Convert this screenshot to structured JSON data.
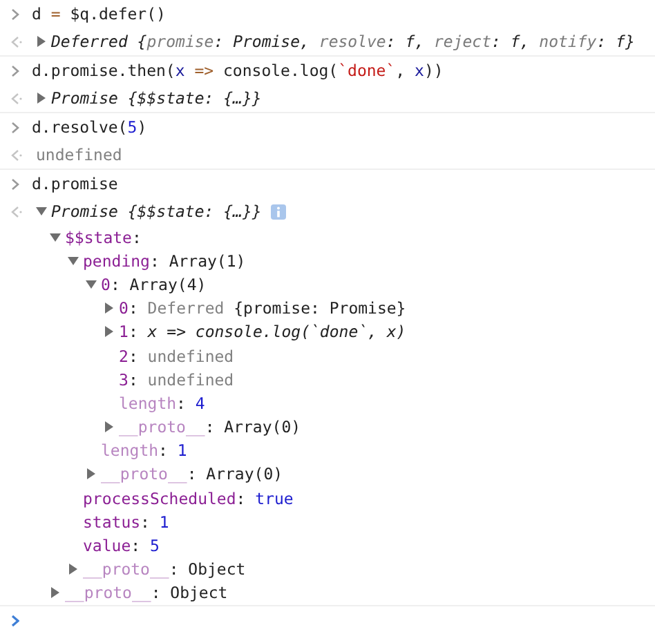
{
  "entries": [
    {
      "input": [
        {
          "text": "d ",
          "kind": "plain"
        },
        {
          "text": "=",
          "kind": "op"
        },
        {
          "text": " $q.defer()",
          "kind": "plain"
        }
      ],
      "result": {
        "expanded": false,
        "tokens": [
          {
            "text": "Deferred {",
            "kind": "italic"
          },
          {
            "text": "promise",
            "kind": "italic-gray"
          },
          {
            "text": ": Promise, ",
            "kind": "italic"
          },
          {
            "text": "resolve",
            "kind": "italic-gray"
          },
          {
            "text": ": f, ",
            "kind": "italic"
          },
          {
            "text": "reject",
            "kind": "italic-gray"
          },
          {
            "text": ": f, ",
            "kind": "italic"
          },
          {
            "text": "notify",
            "kind": "italic-gray"
          },
          {
            "text": ": f}",
            "kind": "italic"
          }
        ]
      }
    },
    {
      "input": [
        {
          "text": "d.promise.then(",
          "kind": "plain"
        },
        {
          "text": "x",
          "kind": "var"
        },
        {
          "text": " =>",
          "kind": "op"
        },
        {
          "text": " console.log(",
          "kind": "plain"
        },
        {
          "text": "`done`",
          "kind": "str"
        },
        {
          "text": ", ",
          "kind": "plain"
        },
        {
          "text": "x",
          "kind": "var"
        },
        {
          "text": "))",
          "kind": "plain"
        }
      ],
      "result": {
        "expanded": false,
        "tokens": [
          {
            "text": "Promise {$$state: {…}}",
            "kind": "italic"
          }
        ]
      }
    },
    {
      "input": [
        {
          "text": "d.resolve(",
          "kind": "plain"
        },
        {
          "text": "5",
          "kind": "num"
        },
        {
          "text": ")",
          "kind": "plain"
        }
      ],
      "result": {
        "tokens": [
          {
            "text": "undefined",
            "kind": "gray"
          }
        ]
      }
    },
    {
      "input": [
        {
          "text": "d.promise",
          "kind": "plain"
        }
      ],
      "result": {
        "expanded": true,
        "info": true,
        "tokens": [
          {
            "text": "Promise {$$state: {…}}",
            "kind": "italic"
          }
        ],
        "children": [
          {
            "expanded": true,
            "tokens": [
              {
                "text": "$$state",
                "kind": "key"
              },
              {
                "text": ":",
                "kind": "plain"
              }
            ],
            "children": [
              {
                "expanded": true,
                "tokens": [
                  {
                    "text": "pending",
                    "kind": "key"
                  },
                  {
                    "text": ": Array(1)",
                    "kind": "plain"
                  }
                ],
                "children": [
                  {
                    "expanded": true,
                    "tokens": [
                      {
                        "text": "0",
                        "kind": "key"
                      },
                      {
                        "text": ": Array(4)",
                        "kind": "plain"
                      }
                    ],
                    "children": [
                      {
                        "expanded": false,
                        "tokens": [
                          {
                            "text": "0",
                            "kind": "key"
                          },
                          {
                            "text": ": ",
                            "kind": "plain"
                          },
                          {
                            "text": "Deferred ",
                            "kind": "gray"
                          },
                          {
                            "text": "{promise: Promise}",
                            "kind": "plain"
                          }
                        ]
                      },
                      {
                        "expanded": false,
                        "tokens": [
                          {
                            "text": "1",
                            "kind": "key"
                          },
                          {
                            "text": ": ",
                            "kind": "plain"
                          },
                          {
                            "text": "x => console.log(`done`, x)",
                            "kind": "italic"
                          }
                        ]
                      },
                      {
                        "tokens": [
                          {
                            "text": "2",
                            "kind": "key"
                          },
                          {
                            "text": ": ",
                            "kind": "plain"
                          },
                          {
                            "text": "undefined",
                            "kind": "gray"
                          }
                        ]
                      },
                      {
                        "tokens": [
                          {
                            "text": "3",
                            "kind": "key"
                          },
                          {
                            "text": ": ",
                            "kind": "plain"
                          },
                          {
                            "text": "undefined",
                            "kind": "gray"
                          }
                        ]
                      },
                      {
                        "tokens": [
                          {
                            "text": "length",
                            "kind": "dim"
                          },
                          {
                            "text": ": ",
                            "kind": "plain"
                          },
                          {
                            "text": "4",
                            "kind": "num"
                          }
                        ]
                      },
                      {
                        "expanded": false,
                        "tokens": [
                          {
                            "text": "__proto__",
                            "kind": "dim"
                          },
                          {
                            "text": ": Array(0)",
                            "kind": "plain"
                          }
                        ]
                      }
                    ]
                  },
                  {
                    "tokens": [
                      {
                        "text": "length",
                        "kind": "dim"
                      },
                      {
                        "text": ": ",
                        "kind": "plain"
                      },
                      {
                        "text": "1",
                        "kind": "num"
                      }
                    ]
                  },
                  {
                    "expanded": false,
                    "tokens": [
                      {
                        "text": "__proto__",
                        "kind": "dim"
                      },
                      {
                        "text": ": Array(0)",
                        "kind": "plain"
                      }
                    ]
                  }
                ]
              },
              {
                "tokens": [
                  {
                    "text": "processScheduled",
                    "kind": "key"
                  },
                  {
                    "text": ": ",
                    "kind": "plain"
                  },
                  {
                    "text": "true",
                    "kind": "num"
                  }
                ]
              },
              {
                "tokens": [
                  {
                    "text": "status",
                    "kind": "key"
                  },
                  {
                    "text": ": ",
                    "kind": "plain"
                  },
                  {
                    "text": "1",
                    "kind": "num"
                  }
                ]
              },
              {
                "tokens": [
                  {
                    "text": "value",
                    "kind": "key"
                  },
                  {
                    "text": ": ",
                    "kind": "plain"
                  },
                  {
                    "text": "5",
                    "kind": "num"
                  }
                ]
              },
              {
                "expanded": false,
                "tokens": [
                  {
                    "text": "__proto__",
                    "kind": "dim"
                  },
                  {
                    "text": ": Object",
                    "kind": "plain"
                  }
                ]
              }
            ]
          },
          {
            "expanded": false,
            "tokens": [
              {
                "text": "__proto__",
                "kind": "dim"
              },
              {
                "text": ": Object",
                "kind": "plain"
              }
            ]
          }
        ]
      }
    }
  ]
}
